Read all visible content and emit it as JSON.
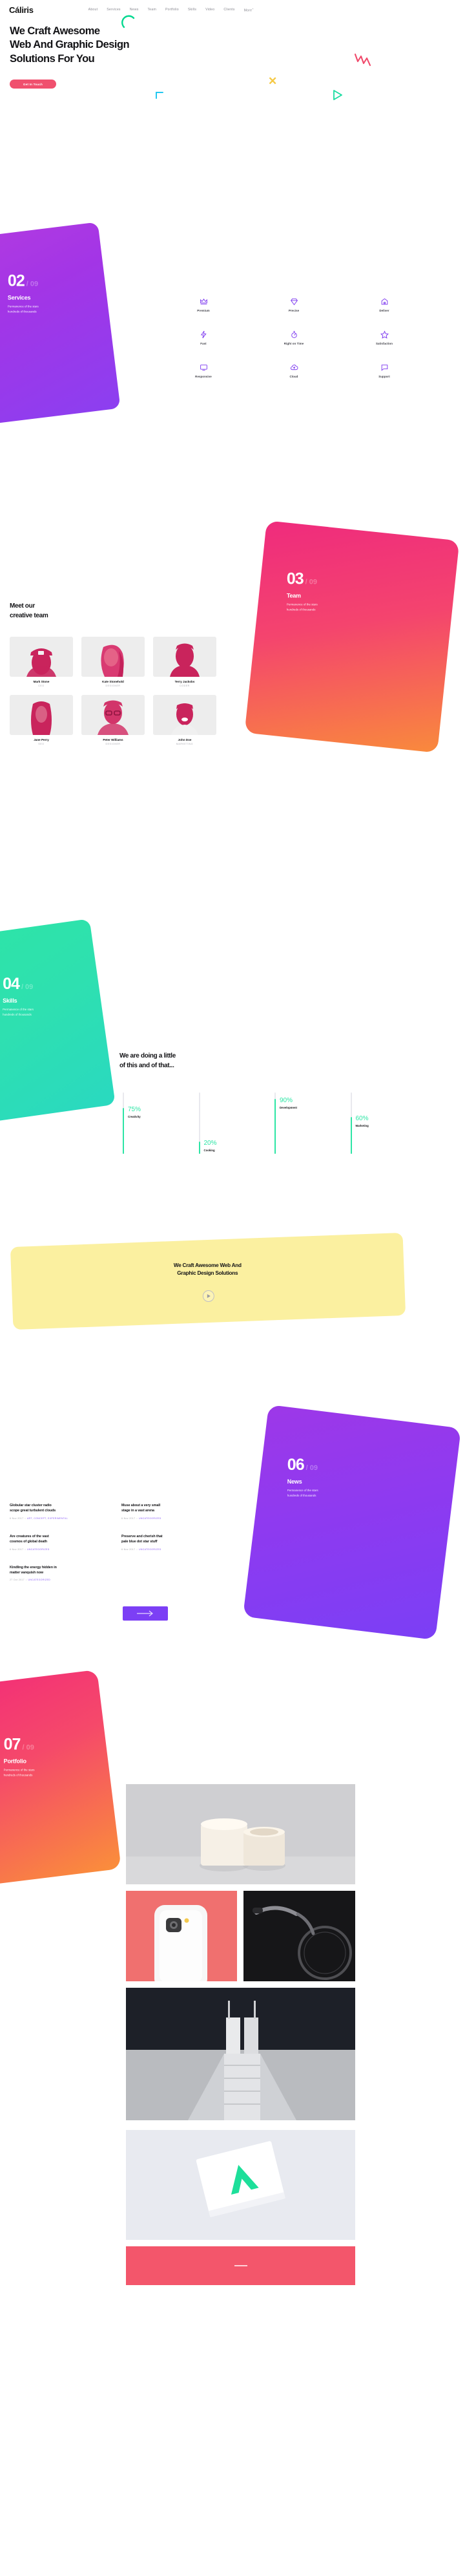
{
  "brand": "Cáliris",
  "nav": {
    "items": [
      "About",
      "Services",
      "News",
      "Team",
      "Portfolio",
      "Skills",
      "Video",
      "Clients"
    ],
    "more": "More",
    "more_sup": "+"
  },
  "hero": {
    "line1": "We Craft Awesome",
    "line2": "Web And Graphic Design",
    "line3": "Solutions For You",
    "cta": "Get In Touch"
  },
  "services": {
    "num": "02",
    "of": "/ 09",
    "title": "Services",
    "sub1": "Permanence of the stars",
    "sub2": "hundreds of thousands",
    "items": [
      {
        "label": "Premium",
        "icon": "crown-icon"
      },
      {
        "label": "Precise",
        "icon": "diamond-icon"
      },
      {
        "label": "Deliver",
        "icon": "home-icon"
      },
      {
        "label": "Fast",
        "icon": "bolt-icon"
      },
      {
        "label": "Right on Time",
        "icon": "stopwatch-icon"
      },
      {
        "label": "Satisfaction",
        "icon": "star-icon"
      },
      {
        "label": "Responsive",
        "icon": "monitor-icon"
      },
      {
        "label": "Cloud",
        "icon": "cloud-upload-icon"
      },
      {
        "label": "Support",
        "icon": "chat-icon"
      }
    ]
  },
  "team": {
    "num": "03",
    "of": "/ 09",
    "title": "Team",
    "sub1": "Permanence of the stars",
    "sub2": "hundreds of thousands",
    "heading_l1": "Meet our",
    "heading_l2": "creative team",
    "members": [
      {
        "name": "Mark Stone",
        "role": "CEO"
      },
      {
        "name": "Kate Stonehold",
        "role": "DESIGNER"
      },
      {
        "name": "Terry Jackobs",
        "role": "CODER"
      },
      {
        "name": "Jane Perry",
        "role": "SEO"
      },
      {
        "name": "Peter Williams",
        "role": "DESIGNER"
      },
      {
        "name": "John Doe",
        "role": "MARKETING"
      }
    ]
  },
  "skills": {
    "num": "04",
    "of": "/ 09",
    "title": "Skills",
    "sub1": "Permanence of the stars",
    "sub2": "hundreds of thousands",
    "heading_l1": "We are doing a little",
    "heading_l2": "of this and of that...",
    "accent": "#2de5a5"
  },
  "chart_data": {
    "type": "bar",
    "title": "We are doing a little of this and of that...",
    "categories": [
      "Creativity",
      "Cooking",
      "Development",
      "Marketing"
    ],
    "values": [
      75,
      20,
      90,
      60
    ],
    "value_labels": [
      "75%",
      "20%",
      "90%",
      "60%"
    ],
    "ylim": [
      0,
      100
    ],
    "ylabel": "",
    "xlabel": "",
    "grid": false,
    "orientation": "vertical",
    "bar_color": "#2de5a5",
    "track_color": "#e9e9ee"
  },
  "video": {
    "line1": "We Craft Awesome Web And",
    "line2": "Graphic Design Solutions",
    "play": "play-button"
  },
  "news": {
    "num": "06",
    "of": "/ 09",
    "title": "News",
    "sub1": "Permanence of the stars",
    "sub2": "hundreds of thousands",
    "posts": [
      {
        "title_l1": "Globular star cluster radio",
        "title_l2": "scope great turbulent clouds",
        "date": "6 Nov 2017",
        "cats": "ART,  CONCEPT,  EXPERIMENTAL"
      },
      {
        "title_l1": "Muse about a very small",
        "title_l2": "stage in a vast arena",
        "date": "6 Nov 2017",
        "cats": "UNCATEGORIZED"
      },
      {
        "title_l1": "Are creatures of the vast",
        "title_l2": "cosmos of global death",
        "date": "6 Nov 2017",
        "cats": "UNCATEGORIZED"
      },
      {
        "title_l1": "Preserve and cherish that",
        "title_l2": "pale blue dot star stuff",
        "date": "6 Nov 2017",
        "cats": "UNCATEGORIZED"
      },
      {
        "title_l1": "Kindling the energy hidden in",
        "title_l2": "matter vanquish now",
        "date": "27 Oct 2017",
        "cats": "UNCATEGORIZED"
      }
    ],
    "more_label": "more-posts-arrow"
  },
  "portfolio": {
    "num": "07",
    "of": "/ 09",
    "title": "Portfolio",
    "sub1": "Permanence of the stars",
    "sub2": "hundreds of thousands"
  },
  "colors": {
    "pink": "#f0506e",
    "purple": "#8c3ff0",
    "green": "#2de5a5",
    "yellow": "#fbf0a0",
    "magenta": "#ef2b7d"
  }
}
